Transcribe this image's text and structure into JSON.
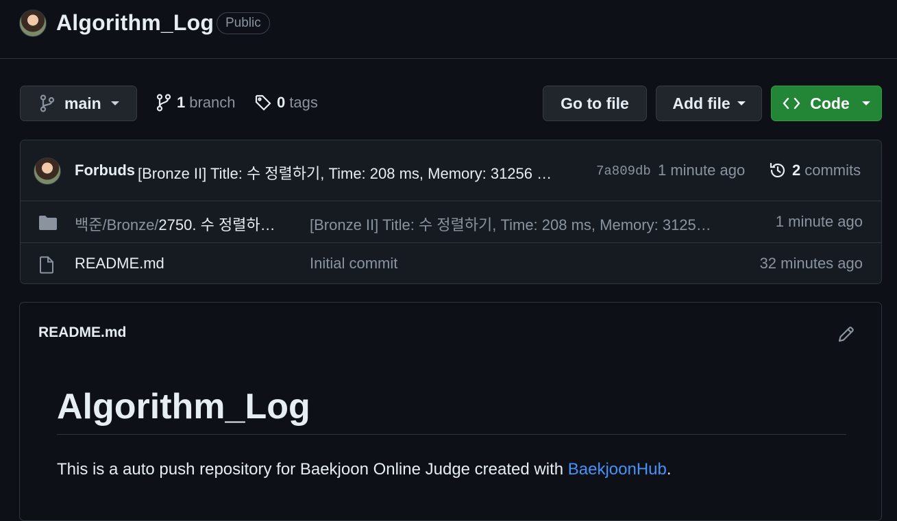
{
  "repo": {
    "name": "Algorithm_Log",
    "visibility": "Public"
  },
  "toolbar": {
    "branch_name": "main",
    "branch_count": "1",
    "branch_word": "branch",
    "tag_count": "0",
    "tag_word": "tags",
    "go_to_file": "Go to file",
    "add_file": "Add file",
    "code": "Code"
  },
  "latest_commit": {
    "author": "Forbuds",
    "message": "[Bronze II] Title: 수 정렬하기, Time: 208 ms, Memory: 31256 …",
    "sha": "7a809db",
    "time": "1 minute ago",
    "commit_count": "2",
    "commit_word": "commits"
  },
  "files": [
    {
      "type": "folder",
      "path_prefix": "백준/Bronze/",
      "name": "2750. 수 정렬하…",
      "message": "[Bronze II] Title: 수 정렬하기, Time: 208 ms, Memory: 3125…",
      "time": "1 minute ago"
    },
    {
      "type": "file",
      "path_prefix": "",
      "name": "README.md",
      "message": "Initial commit",
      "time": "32 minutes ago"
    }
  ],
  "readme": {
    "header_title": "README.md",
    "heading": "Algorithm_Log",
    "text_before": "This is a auto push repository for Baekjoon Online Judge created with ",
    "link_text": "BaekjoonHub",
    "text_after": "."
  },
  "colors": {
    "background": "#0d1117",
    "code_button": "#238636",
    "link": "#4493f8"
  },
  "icons": [
    "branch-icon",
    "tag-icon",
    "history-icon",
    "folder-icon",
    "file-icon",
    "code-icon",
    "pencil-icon"
  ]
}
